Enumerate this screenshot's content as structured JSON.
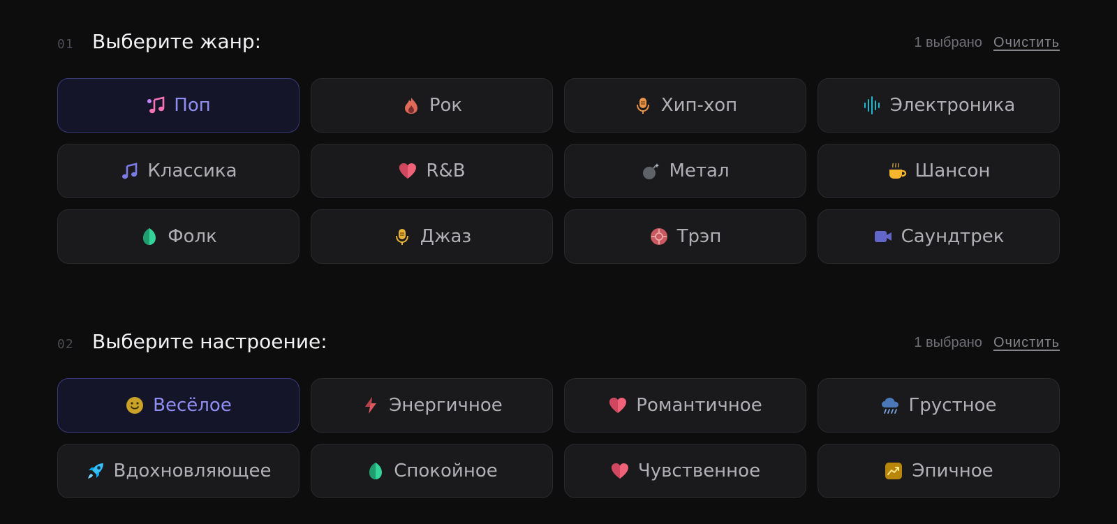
{
  "genre": {
    "num": "01",
    "title": "Выберите жанр:",
    "count": "1 выбрано",
    "clear": "Очистить",
    "options": [
      {
        "label": "Поп",
        "icon": "music-notes-icon",
        "selected": true
      },
      {
        "label": "Рок",
        "icon": "fire-icon",
        "selected": false
      },
      {
        "label": "Хип-хоп",
        "icon": "microphone-icon",
        "selected": false
      },
      {
        "label": "Электроника",
        "icon": "sound-wave-icon",
        "selected": false
      },
      {
        "label": "Классика",
        "icon": "music-note-icon",
        "selected": false
      },
      {
        "label": "R&B",
        "icon": "heart-icon",
        "selected": false
      },
      {
        "label": "Метал",
        "icon": "bomb-icon",
        "selected": false
      },
      {
        "label": "Шансон",
        "icon": "coffee-cup-icon",
        "selected": false
      },
      {
        "label": "Фолк",
        "icon": "leaf-icon",
        "selected": false
      },
      {
        "label": "Джаз",
        "icon": "microphone-icon",
        "selected": false
      },
      {
        "label": "Трэп",
        "icon": "crosshair-icon",
        "selected": false
      },
      {
        "label": "Саундтрек",
        "icon": "video-camera-icon",
        "selected": false
      }
    ]
  },
  "mood": {
    "num": "02",
    "title": "Выберите настроение:",
    "count": "1 выбрано",
    "clear": "Очистить",
    "options": [
      {
        "label": "Весёлое",
        "icon": "smiley-icon",
        "selected": true
      },
      {
        "label": "Энергичное",
        "icon": "lightning-icon",
        "selected": false
      },
      {
        "label": "Романтичное",
        "icon": "heart-icon",
        "selected": false
      },
      {
        "label": "Грустное",
        "icon": "rain-cloud-icon",
        "selected": false
      },
      {
        "label": "Вдохновляющее",
        "icon": "rocket-icon",
        "selected": false
      },
      {
        "label": "Спокойное",
        "icon": "leaf-icon",
        "selected": false
      },
      {
        "label": "Чувственное",
        "icon": "heart-icon",
        "selected": false
      },
      {
        "label": "Эпичное",
        "icon": "chart-up-icon",
        "selected": false
      }
    ]
  },
  "colors": {
    "background": "#0d0d0e",
    "card": "#1a1a1c",
    "selected_card": "#15152a",
    "selected_border": "#3a3a78",
    "selected_text": "#8f8ef2"
  }
}
